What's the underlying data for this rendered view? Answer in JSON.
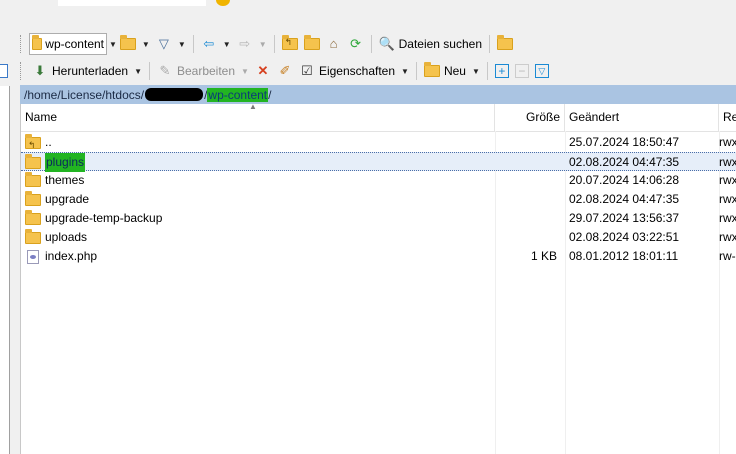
{
  "toolbar1": {
    "folder_combo": "wp-content",
    "find_files": "Dateien suchen"
  },
  "toolbar2": {
    "download": "Herunterladen",
    "edit": "Bearbeiten",
    "properties": "Eigenschaften",
    "new": "Neu"
  },
  "path": {
    "prefix": "/home/License/htdocs/",
    "sep": "/",
    "current": "wp-content",
    "trail": "/"
  },
  "columns": {
    "name": "Name",
    "size": "Größe",
    "modified": "Geändert",
    "rights": "Rechte"
  },
  "files": [
    {
      "name": "..",
      "size": "",
      "modified": "25.07.2024 18:50:47",
      "rights": "rwxr-xr-x",
      "type": "parent"
    },
    {
      "name": "plugins",
      "size": "",
      "modified": "02.08.2024 04:47:35",
      "rights": "rwxr-xr-x",
      "type": "folder"
    },
    {
      "name": "themes",
      "size": "",
      "modified": "20.07.2024 14:06:28",
      "rights": "rwxr-xr-x",
      "type": "folder"
    },
    {
      "name": "upgrade",
      "size": "",
      "modified": "02.08.2024 04:47:35",
      "rights": "rwxr-xr-x",
      "type": "folder"
    },
    {
      "name": "upgrade-temp-backup",
      "size": "",
      "modified": "29.07.2024 13:56:37",
      "rights": "rwxr-xr-x",
      "type": "folder"
    },
    {
      "name": "uploads",
      "size": "",
      "modified": "02.08.2024 03:22:51",
      "rights": "rwxr-xr-x",
      "type": "folder"
    },
    {
      "name": "index.php",
      "size": "1 KB",
      "modified": "08.01.2012 18:01:11",
      "rights": "rw-r--r--",
      "type": "php"
    }
  ],
  "colors": {
    "path_bg": "#aac4e2",
    "highlight": "#22b422",
    "selected_row": "#e6eef9"
  }
}
